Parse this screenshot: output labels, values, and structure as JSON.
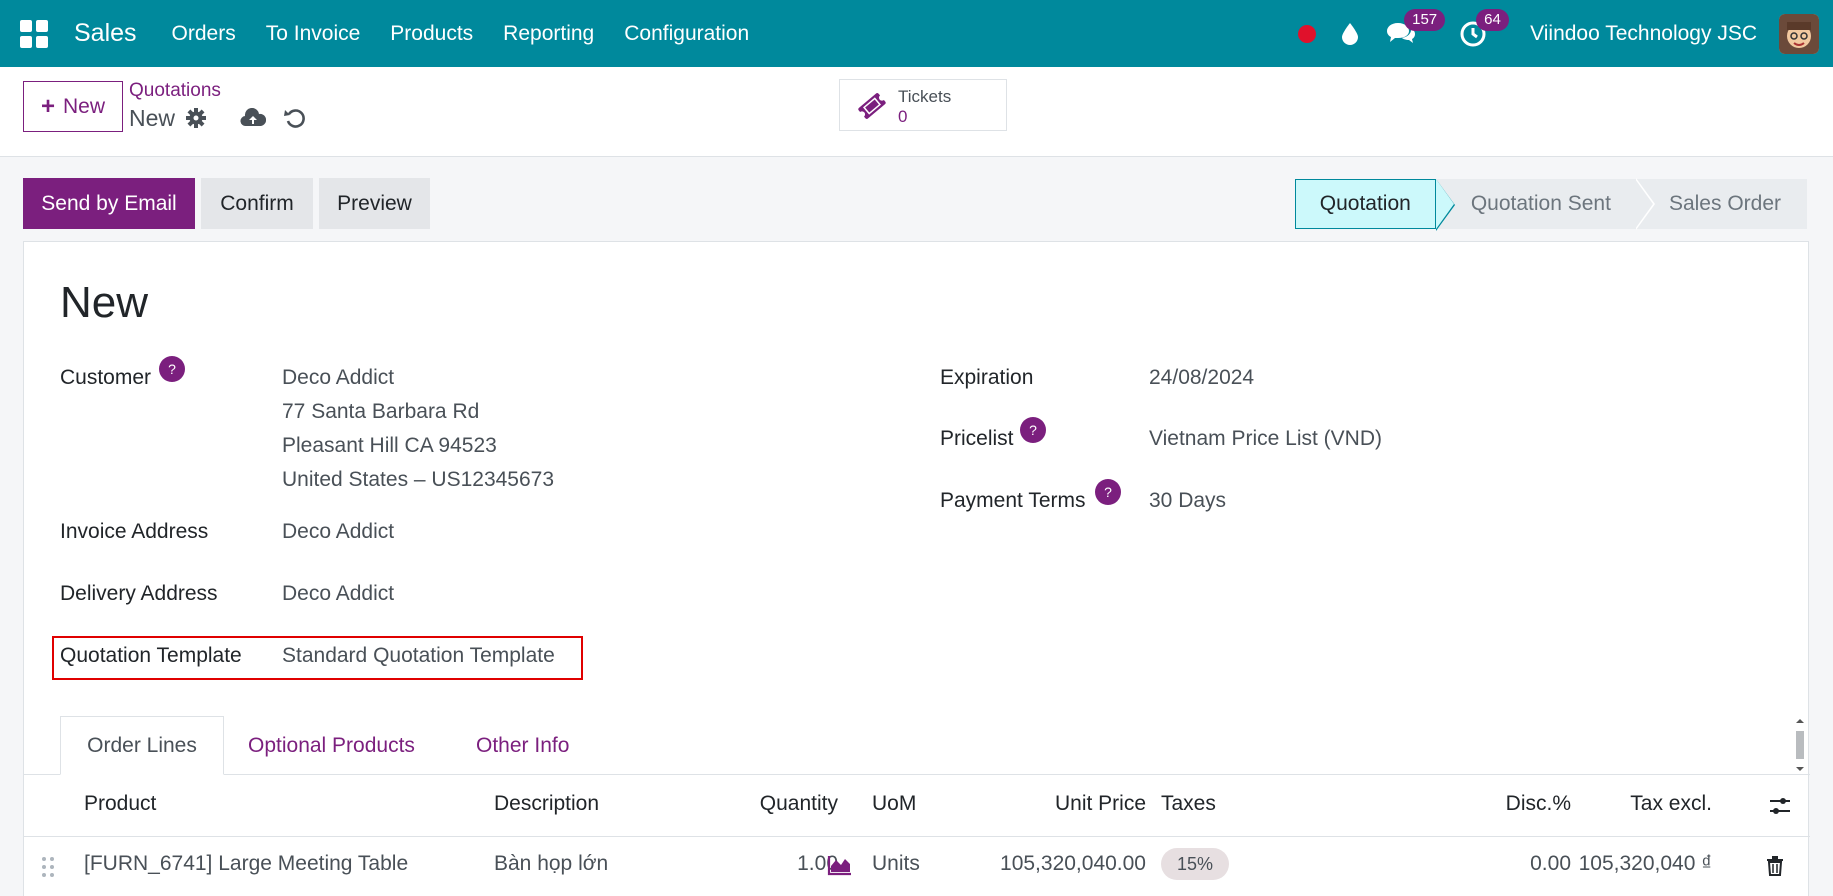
{
  "navbar": {
    "app_name": "Sales",
    "menu": [
      "Orders",
      "To Invoice",
      "Products",
      "Reporting",
      "Configuration"
    ],
    "messages_count": "157",
    "activities_count": "64",
    "company": "Viindoo Technology JSC",
    "colors": {
      "bar": "#00899c",
      "badge": "#7b1f7e",
      "record": "#e0112b"
    }
  },
  "control": {
    "new_label": "New",
    "breadcrumb": "Quotations",
    "record_name": "New",
    "tickets_label": "Tickets",
    "tickets_count": "0"
  },
  "actions": {
    "send_email": "Send by Email",
    "confirm": "Confirm",
    "preview": "Preview"
  },
  "statusbar": {
    "stages": [
      "Quotation",
      "Quotation Sent",
      "Sales Order"
    ],
    "active": "Quotation"
  },
  "form": {
    "title": "New",
    "customer_label": "Customer",
    "customer_lines": [
      "Deco Addict",
      "77 Santa Barbara Rd",
      "Pleasant Hill CA 94523",
      "United States – US12345673"
    ],
    "invoice_address_label": "Invoice Address",
    "invoice_address": "Deco Addict",
    "delivery_address_label": "Delivery Address",
    "delivery_address": "Deco Addict",
    "template_label": "Quotation Template",
    "template_value": "Standard Quotation Template",
    "expiration_label": "Expiration",
    "expiration_value": "24/08/2024",
    "pricelist_label": "Pricelist",
    "pricelist_value": "Vietnam Price List (VND)",
    "payment_terms_label": "Payment Terms",
    "payment_terms_value": "30 Days",
    "help_glyph": "?"
  },
  "tabs": [
    "Order Lines",
    "Optional Products",
    "Other Info"
  ],
  "table": {
    "columns": {
      "product": "Product",
      "description": "Description",
      "quantity": "Quantity",
      "uom": "UoM",
      "unit_price": "Unit Price",
      "taxes": "Taxes",
      "discount": "Disc.%",
      "tax_excl": "Tax excl."
    },
    "rows": [
      {
        "product": "[FURN_6741] Large Meeting Table",
        "description": "Bàn họp lớn",
        "quantity": "1.00",
        "uom": "Units",
        "unit_price": "105,320,040.00",
        "taxes": "15%",
        "discount": "0.00",
        "tax_excl": "105,320,040 ₫"
      }
    ]
  }
}
